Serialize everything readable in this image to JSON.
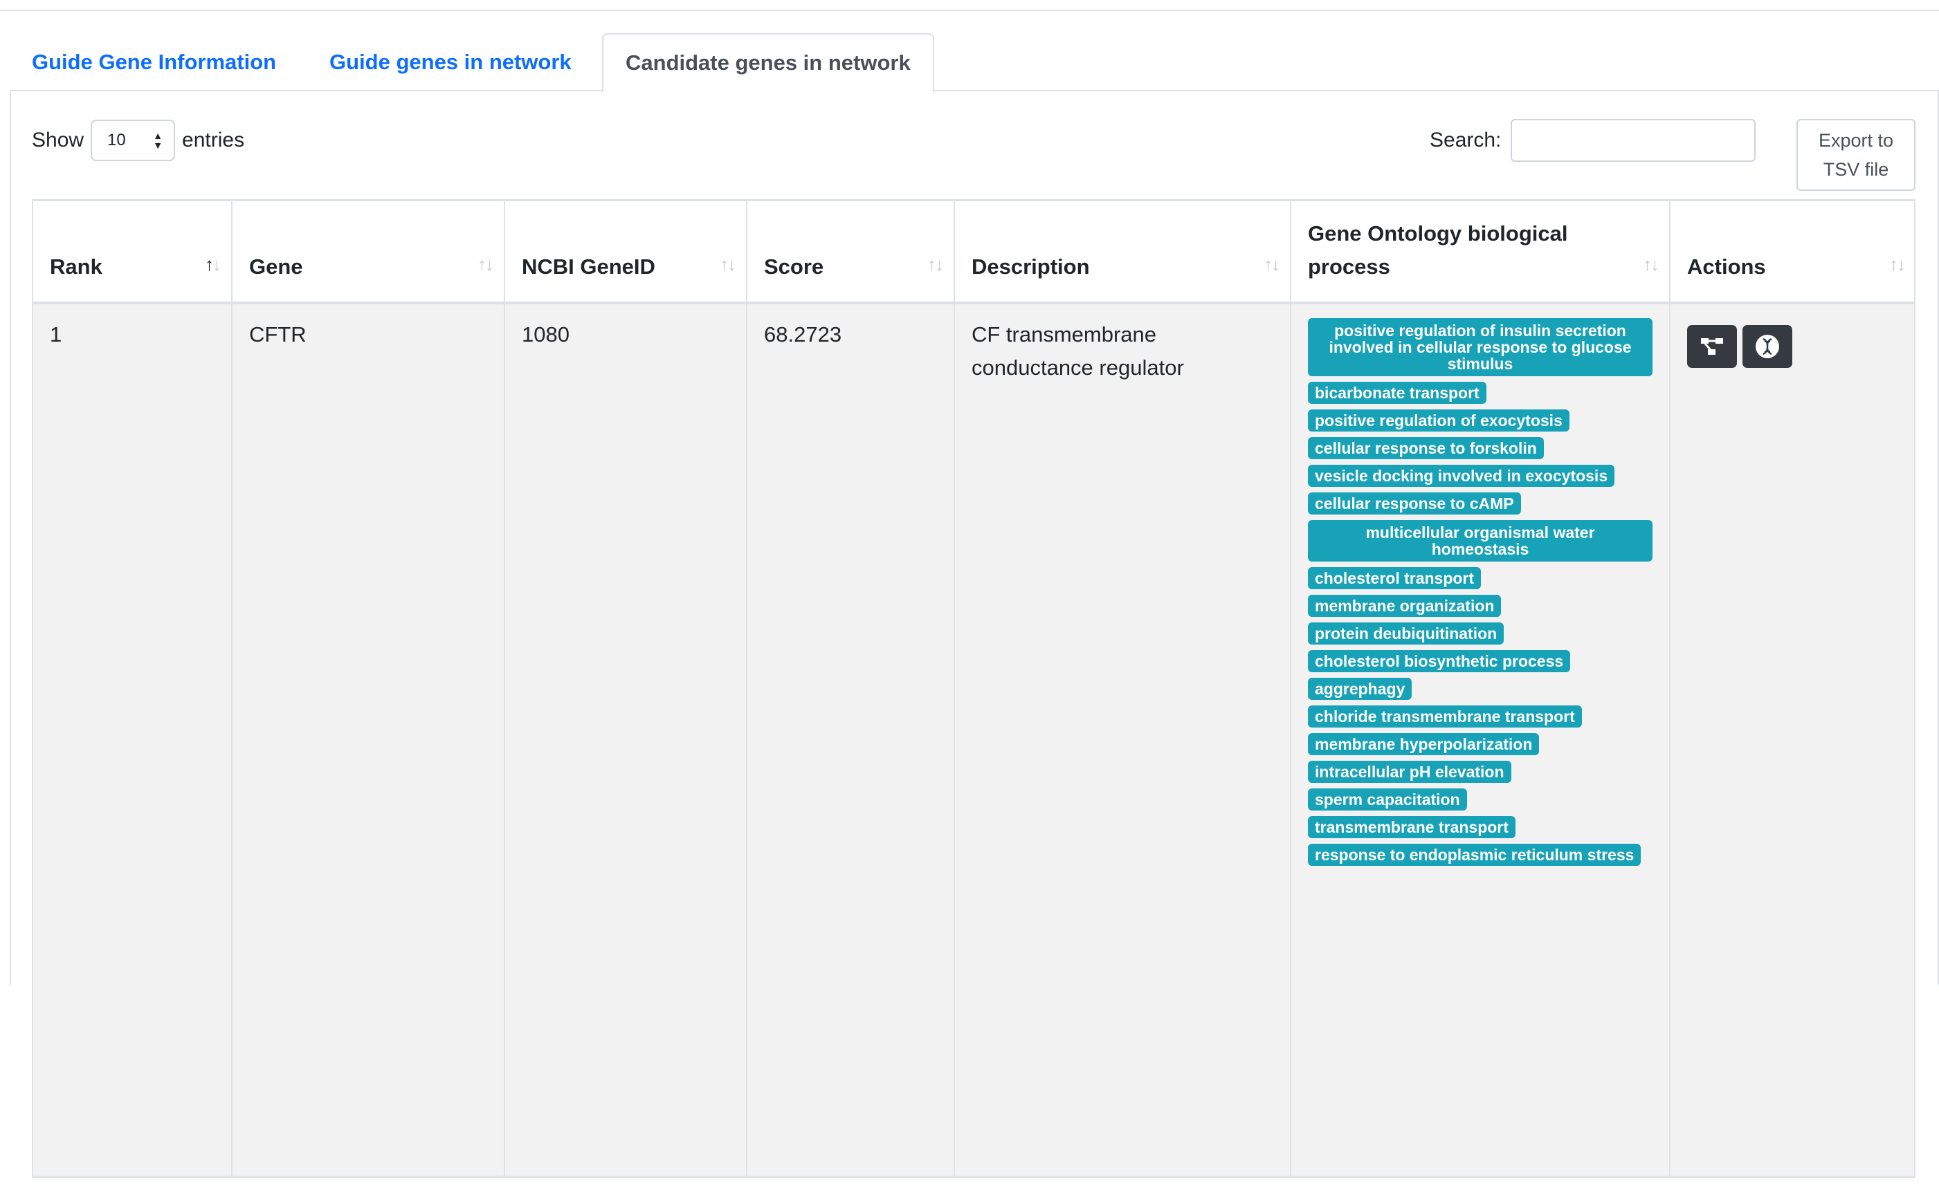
{
  "tabs": [
    {
      "label": "Guide Gene Information"
    },
    {
      "label": "Guide genes in network"
    },
    {
      "label": "Candidate genes in network",
      "active": true
    }
  ],
  "length": {
    "show": "Show",
    "value": "10",
    "entries": "entries"
  },
  "search": {
    "label": "Search:",
    "value": ""
  },
  "export": {
    "label": "Export to TSV file"
  },
  "table": {
    "columns": [
      "Rank",
      "Gene",
      "NCBI GeneID",
      "Score",
      "Description",
      "Gene Ontology biological process",
      "Actions"
    ],
    "sorted_column": "Rank",
    "rows": [
      {
        "rank": "1",
        "gene": "CFTR",
        "ncbi_geneid": "1080",
        "score": "68.2723",
        "description": "CF transmembrane conductance regulator",
        "go_processes": [
          "positive regulation of insulin secretion involved in cellular response to glucose stimulus",
          "bicarbonate transport",
          "positive regulation of exocytosis",
          "cellular response to forskolin",
          "vesicle docking involved in exocytosis",
          "cellular response to cAMP",
          "multicellular organismal water homeostasis",
          "cholesterol transport",
          "membrane organization",
          "protein deubiquitination",
          "cholesterol biosynthetic process",
          "aggrephagy",
          "chloride transmembrane transport",
          "membrane hyperpolarization",
          "intracellular pH elevation",
          "sperm capacitation",
          "transmembrane transport",
          "response to endoplasmic reticulum stress"
        ],
        "actions": [
          "network-icon",
          "dna-icon"
        ]
      }
    ]
  },
  "colors": {
    "accent": "#0d6efd",
    "badge": "#17a2b8",
    "action": "#343a40",
    "row_bg": "#f2f2f2"
  }
}
